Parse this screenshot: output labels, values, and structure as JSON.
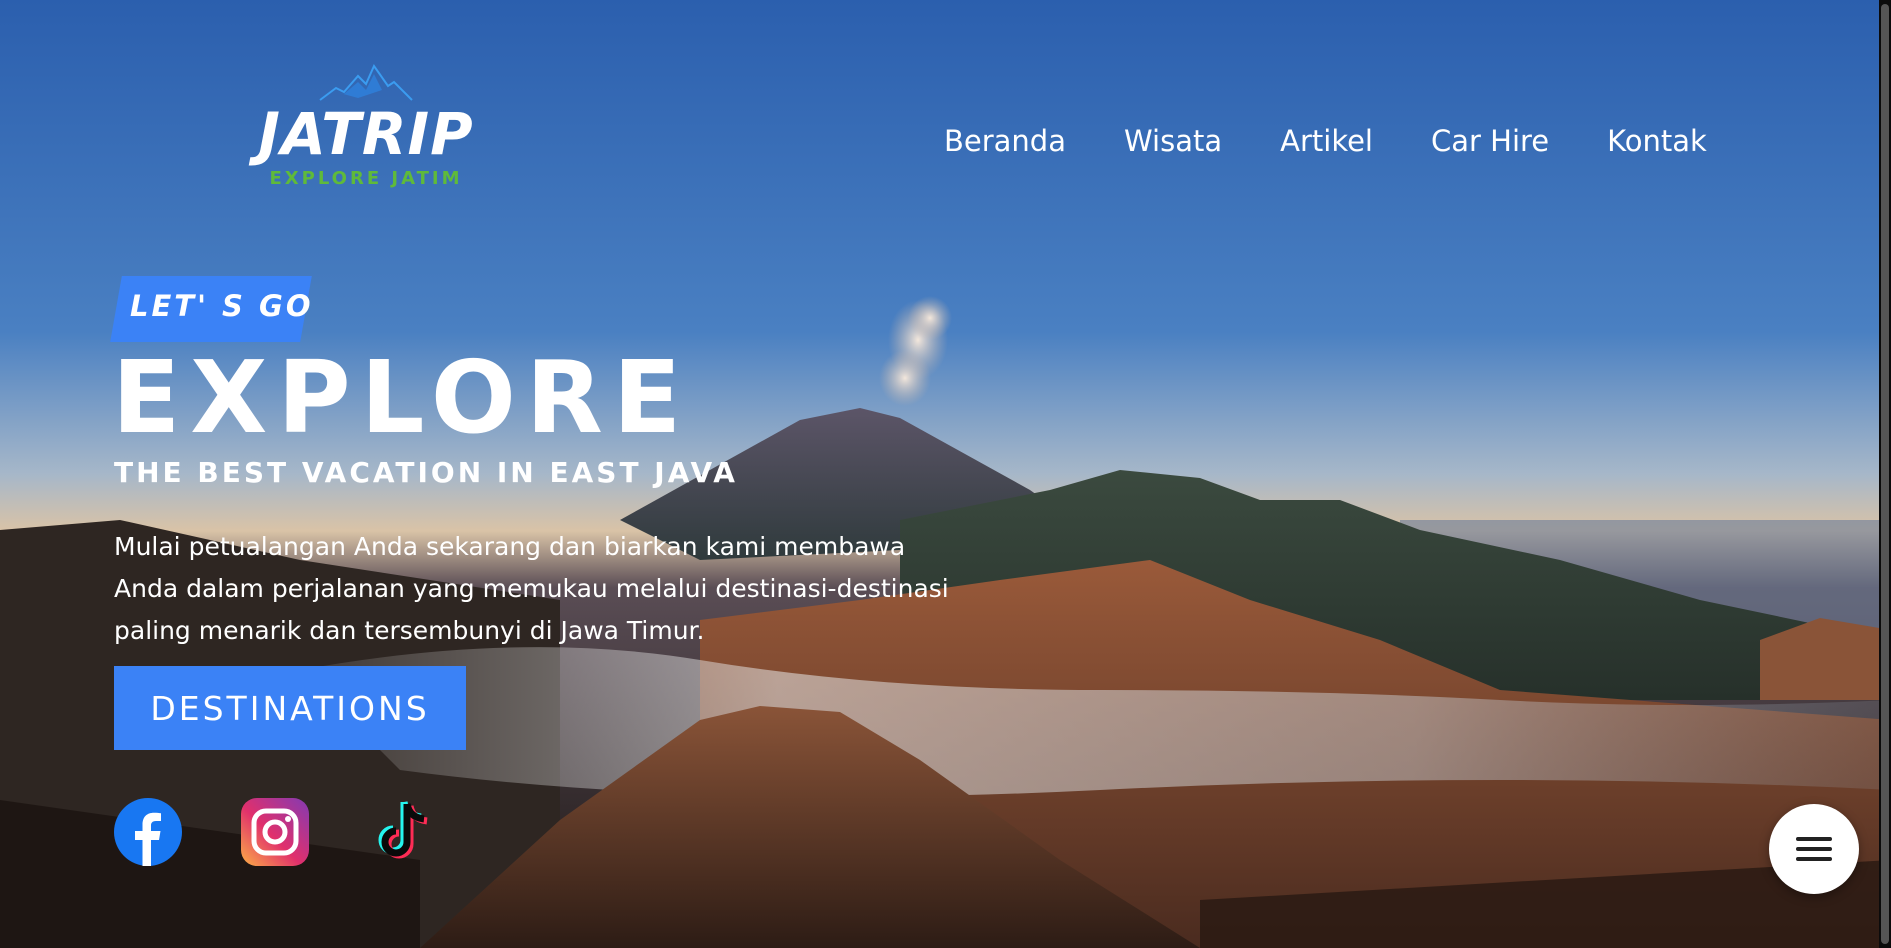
{
  "brand": {
    "logo_title": "JATRIP",
    "logo_tagline": "EXPLORE JATIM",
    "logo_icon": "mountain-icon"
  },
  "nav": {
    "items": [
      {
        "label": "Beranda"
      },
      {
        "label": "Wisata"
      },
      {
        "label": "Artikel"
      },
      {
        "label": "Car Hire"
      },
      {
        "label": "Kontak"
      }
    ]
  },
  "hero": {
    "badge": "LET' S GO",
    "headline": "EXPLORE",
    "subheadline": "THE BEST VACATION IN EAST JAVA",
    "description": "Mulai petualangan Anda sekarang dan biarkan kami membawa Anda dalam perjalanan yang memukau melalui destinasi-destinasi paling menarik dan tersembunyi di Jawa Timur.",
    "cta_label": "DESTINATIONS"
  },
  "socials": [
    {
      "icon": "facebook-icon"
    },
    {
      "icon": "instagram-icon"
    },
    {
      "icon": "tiktok-icon"
    }
  ],
  "fab": {
    "icon": "hamburger-menu-icon"
  },
  "colors": {
    "accent": "#3b82f6",
    "tagline_green": "#5fba3a",
    "text": "#ffffff"
  }
}
